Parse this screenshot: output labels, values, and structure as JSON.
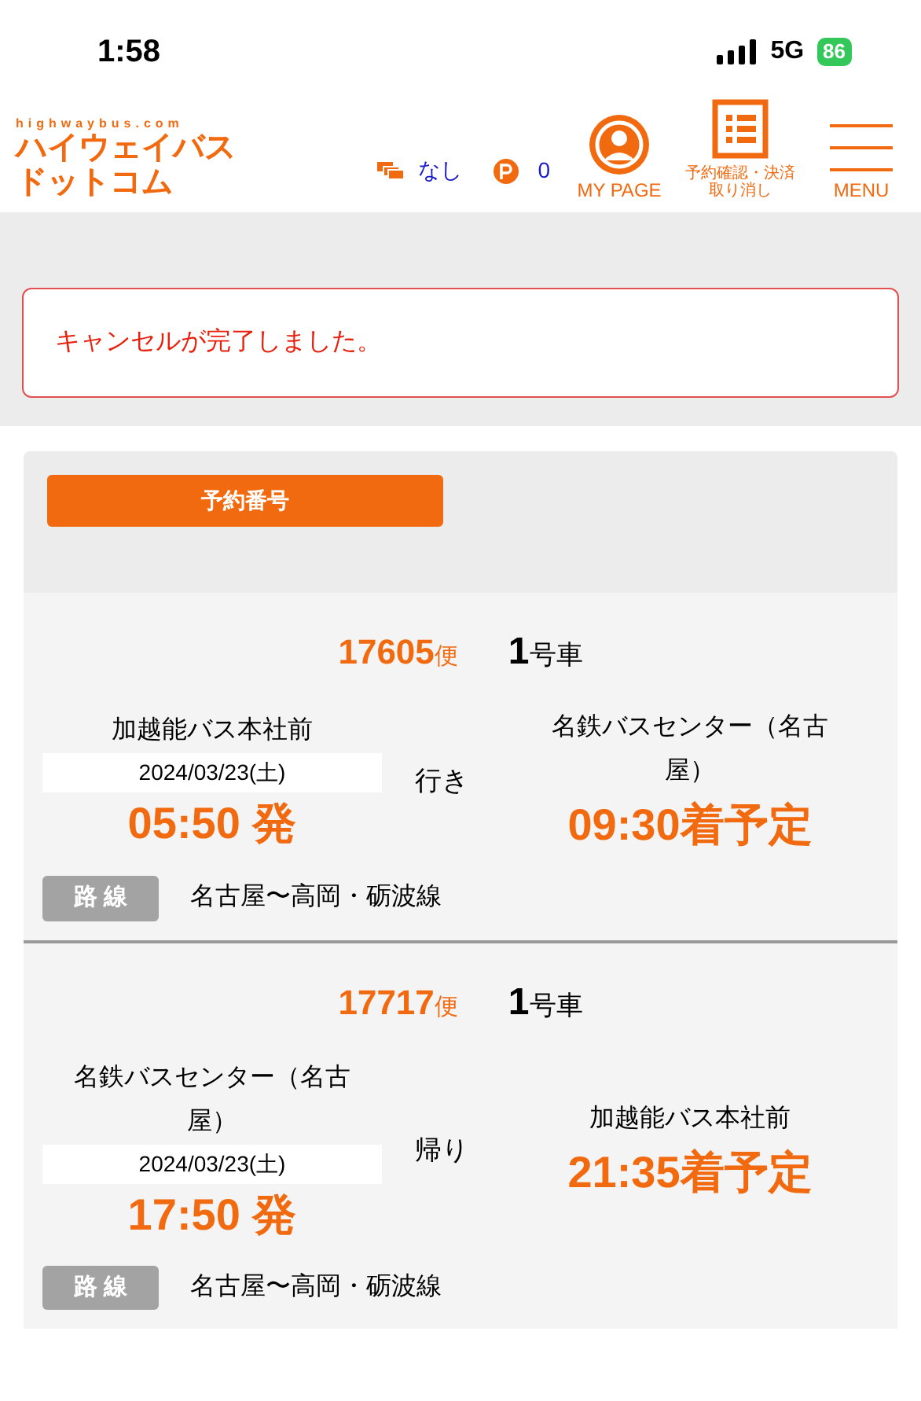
{
  "status_bar": {
    "time": "1:58",
    "network": "5G",
    "battery": "86"
  },
  "header": {
    "logo_url": "highwaybus.com",
    "logo_lines": [
      "ハイウェイバス",
      "ドットコム"
    ],
    "coupons": "なし",
    "points": "0",
    "nav": [
      {
        "kind": "user",
        "label": "MY PAGE"
      },
      {
        "kind": "list",
        "label": [
          "予約確認・決済",
          "取り消し"
        ]
      },
      {
        "kind": "menu",
        "label": "MENU"
      }
    ]
  },
  "alert": {
    "message": "キャンセルが完了しました。"
  },
  "reservation": {
    "number_label": "予約番号",
    "trips": [
      {
        "flight": "17605",
        "flight_unit": "便",
        "car": "1",
        "car_unit": "号車",
        "from": "加越能バス本社前",
        "date": "2024/03/23(土)",
        "depart": "05:50 発",
        "direction": "行き",
        "to": "名鉄バスセンター（名古屋）",
        "arrive": "09:30着予定",
        "route_label": "路 線",
        "route": "名古屋〜高岡・砺波線"
      },
      {
        "flight": "17717",
        "flight_unit": "便",
        "car": "1",
        "car_unit": "号車",
        "from": "名鉄バスセンター（名古屋）",
        "date": "2024/03/23(土)",
        "depart": "17:50 発",
        "direction": "帰り",
        "to": "加越能バス本社前",
        "arrive": "21:35着予定",
        "route_label": "路 線",
        "route": "名古屋〜高岡・砺波線"
      }
    ]
  }
}
